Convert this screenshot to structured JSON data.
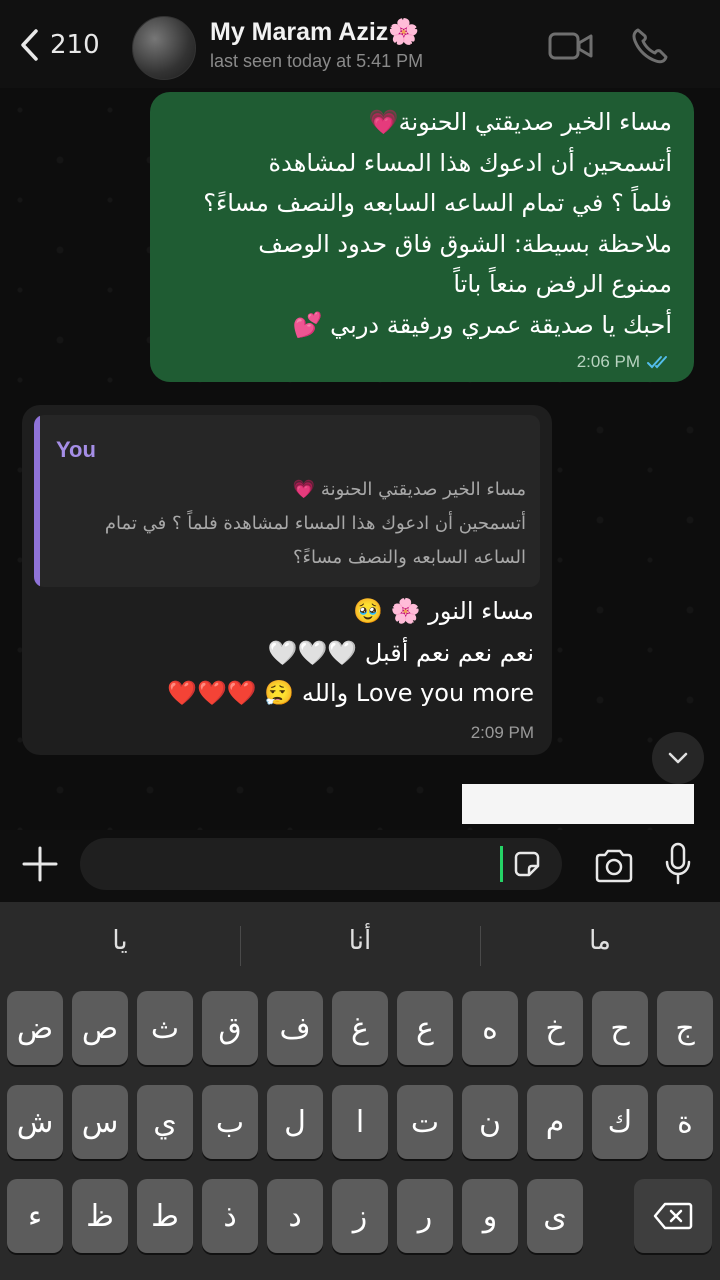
{
  "header": {
    "back_count": "210",
    "contact_name": "My Maram Aziz🌸",
    "last_seen": "last seen today at 5:41 PM"
  },
  "outgoing": {
    "lines": [
      "مساء الخير صديقتي الحنونة💗",
      "أتسمحين أن ادعوك هذا المساء لمشاهدة",
      "فلماً ؟ في تمام الساعه السابعه والنصف مساءً؟",
      "ملاحظة بسيطة: الشوق فاق حدود الوصف",
      "ممنوع الرفض منعاً باتاً",
      "أحبك يا صديقة عمري ورفيقة دربي 💕"
    ],
    "time": "2:06 PM",
    "read_color": "#53bdeb"
  },
  "incoming": {
    "quote_author": "You",
    "quote_lines": [
      "مساء الخير صديقتي الحنونة 💗",
      "أتسمحين أن ادعوك هذا المساء لمشاهدة فلماً ؟ في تمام",
      "الساعه السابعه والنصف مساءً؟"
    ],
    "lines": [
      "مساء النور 🌸 🥹",
      "نعم نعم نعم أقبل 🤍🤍🤍",
      "Love you more والله 😮‍💨 ❤️❤️❤️"
    ],
    "time": "2:09 PM"
  },
  "input": {
    "placeholder": ""
  },
  "keyboard": {
    "suggestions": [
      "يا",
      "أنا",
      "ما"
    ],
    "row1": [
      "ض",
      "ص",
      "ث",
      "ق",
      "ف",
      "غ",
      "ع",
      "ه",
      "خ",
      "ح",
      "ج"
    ],
    "row2": [
      "ش",
      "س",
      "ي",
      "ب",
      "ل",
      "ا",
      "ت",
      "ن",
      "م",
      "ك",
      "ة"
    ],
    "row3": [
      "ء",
      "ظ",
      "ط",
      "ذ",
      "د",
      "ز",
      "ر",
      "و",
      "ى"
    ]
  },
  "colors": {
    "outgoing_bubble": "#1f5c33",
    "incoming_bubble": "#1e1e1e",
    "quote_accent": "#8f73d8",
    "caret": "#25d366"
  }
}
